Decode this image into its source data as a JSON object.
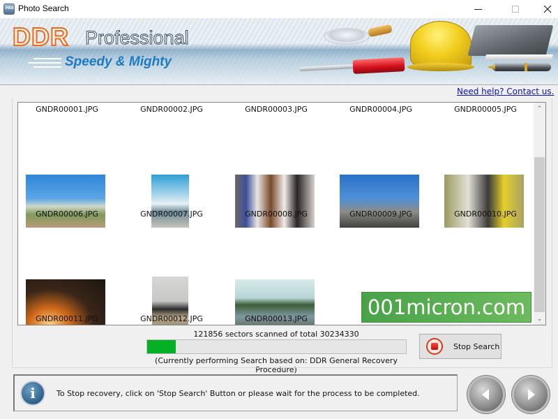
{
  "window": {
    "title": "Photo Search",
    "icon": "app-pro-icon",
    "controls": [
      "minimize",
      "maximize",
      "close"
    ]
  },
  "banner": {
    "brand": "DDR",
    "product": "Professional",
    "tagline": "Speedy & Mighty"
  },
  "help_link": "Need help? Contact us.",
  "files": [
    {
      "name": "GNDR00001.JPG",
      "has_thumbnail": false
    },
    {
      "name": "GNDR00002.JPG",
      "has_thumbnail": false
    },
    {
      "name": "GNDR00003.JPG",
      "has_thumbnail": false
    },
    {
      "name": "GNDR00004.JPG",
      "has_thumbnail": false
    },
    {
      "name": "GNDR00005.JPG",
      "has_thumbnail": false
    },
    {
      "name": "GNDR00006.JPG",
      "has_thumbnail": true,
      "subject": "palm trees and palace"
    },
    {
      "name": "GNDR00007.JPG",
      "has_thumbnail": true,
      "subject": "group of girls by lake under blue sky"
    },
    {
      "name": "GNDR00008.JPG",
      "has_thumbnail": true,
      "subject": "five young women posing"
    },
    {
      "name": "GNDR00009.JPG",
      "has_thumbnail": true,
      "subject": "friends on rooftop"
    },
    {
      "name": "GNDR00010.JPG",
      "has_thumbnail": true,
      "subject": "seniors taking selfie in park"
    },
    {
      "name": "GNDR00011.JPG",
      "has_thumbnail": true,
      "subject": "two men by campfire"
    },
    {
      "name": "GNDR00012.JPG",
      "has_thumbnail": true,
      "subject": "two people sitting on steps"
    },
    {
      "name": "GNDR00013.JPG",
      "has_thumbnail": true,
      "subject": "group jumping by lake"
    }
  ],
  "watermark": "001micron.com",
  "progress": {
    "sectors_scanned": 121856,
    "sectors_total": 30234330,
    "label": "121856 sectors scanned of total 30234330",
    "bar_fraction": 0.11,
    "procedure": "(Currently performing Search based on:  DDR General Recovery Procedure)"
  },
  "stop_button": {
    "label": "Stop Search"
  },
  "info": {
    "message": "To Stop recovery, click on 'Stop Search' Button or please wait for the process to be completed."
  },
  "navigation": {
    "back": "back-arrow",
    "next": "next-arrow"
  },
  "colors": {
    "progress_fill": "#06b025",
    "link": "#0b11b3",
    "brand_orange": "#e86a1e",
    "tagline_blue": "#1e7ac0",
    "watermark_green": "#4fa84c"
  }
}
